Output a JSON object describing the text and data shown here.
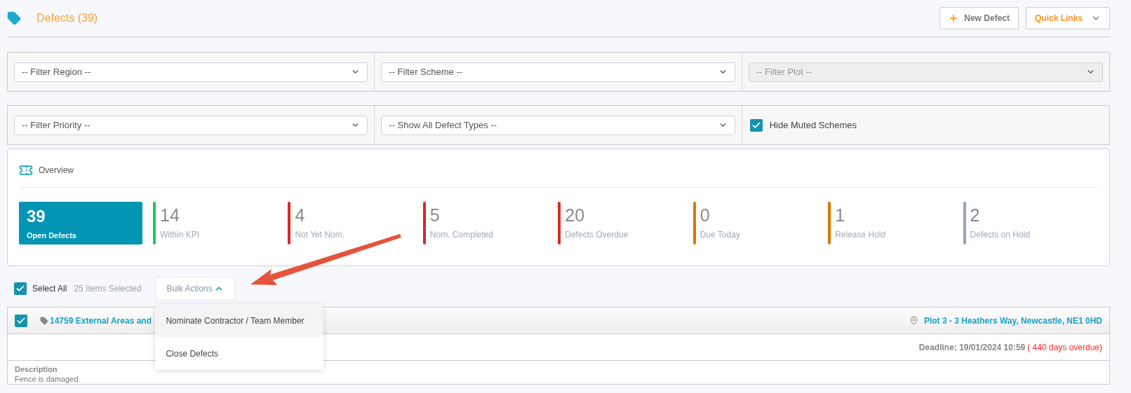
{
  "header": {
    "title": "Defects (39)",
    "new_button": "New Defect",
    "quick_links": "Quick Links"
  },
  "filter_rows": [
    {
      "cells": [
        {
          "kind": "select",
          "value": "-- Filter Region --",
          "disabled": false
        },
        {
          "kind": "select",
          "value": "-- Filter Scheme --",
          "disabled": false
        },
        {
          "kind": "select",
          "value": "-- Filter Plot --",
          "disabled": true
        }
      ]
    },
    {
      "cells": [
        {
          "kind": "select",
          "value": "-- Filter Priority --",
          "disabled": false
        },
        {
          "kind": "select",
          "value": "-- Show All Defect Types --",
          "disabled": false
        },
        {
          "kind": "checkbox",
          "label": "Hide Muted Schemes",
          "checked": true
        }
      ]
    }
  ],
  "overview": {
    "title": "Overview",
    "primary": {
      "value": "39",
      "label": "Open Defects"
    },
    "stats": [
      {
        "value": "14",
        "label": "Within KPI",
        "color": "#22c55e"
      },
      {
        "value": "4",
        "label": "Not Yet Nom.",
        "color": "#dc2626"
      },
      {
        "value": "5",
        "label": "Nom. Completed",
        "color": "#dc2626"
      },
      {
        "value": "20",
        "label": "Defects Overdue",
        "color": "#dc2626"
      },
      {
        "value": "0",
        "label": "Due Today",
        "color": "#d97706"
      },
      {
        "value": "1",
        "label": "Release Hold",
        "color": "#d97706"
      },
      {
        "value": "2",
        "label": "Defects on Hold",
        "color": "#94a3b8"
      }
    ]
  },
  "toolbar": {
    "select_all": {
      "label": "Select All",
      "checked": true
    },
    "selected_count": "25 Items Selected",
    "bulk_actions": {
      "label": "Bulk Actions",
      "expanded": true
    },
    "menu": [
      {
        "label": "Nominate Contractor / Team Member",
        "highlighted": true
      },
      {
        "label": "Close Defects",
        "highlighted": false
      }
    ]
  },
  "defect": {
    "checked": true,
    "title": "14759 External Areas and",
    "location": "Plot 3 - 3 Heathers Way, Newcastle, NE1 0HD",
    "deadline": "Deadline: 19/01/2024 10:59",
    "overdue": "( 440 days overdue)",
    "description_label": "Description",
    "description": "Fence is damaged"
  }
}
